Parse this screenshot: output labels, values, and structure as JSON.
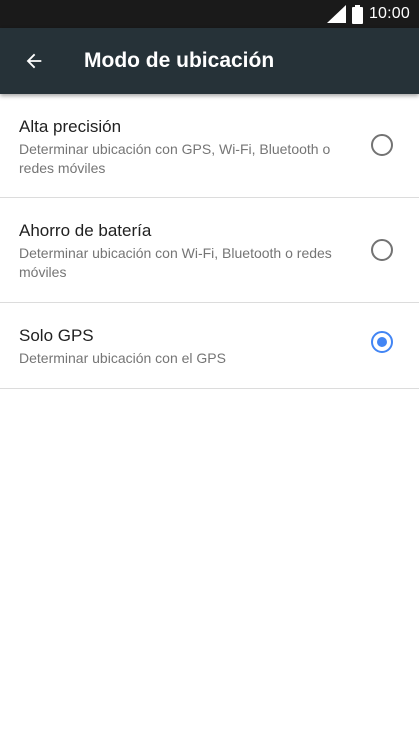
{
  "status_bar": {
    "time": "10:00",
    "signal_icon": "signal-icon",
    "battery_icon": "battery-icon"
  },
  "app_bar": {
    "back_icon": "arrow-back-icon",
    "title": "Modo de ubicación",
    "color": "#263238"
  },
  "options": [
    {
      "title": "Alta precisión",
      "description": "Determinar ubicación con GPS, Wi-Fi, Bluetooth o redes móviles",
      "selected": false
    },
    {
      "title": "Ahorro de batería",
      "description": "Determinar ubicación con Wi-Fi, Bluetooth o redes móviles",
      "selected": false
    },
    {
      "title": "Solo GPS",
      "description": "Determinar ubicación con el GPS",
      "selected": true
    }
  ],
  "accent_color": "#4285f4"
}
